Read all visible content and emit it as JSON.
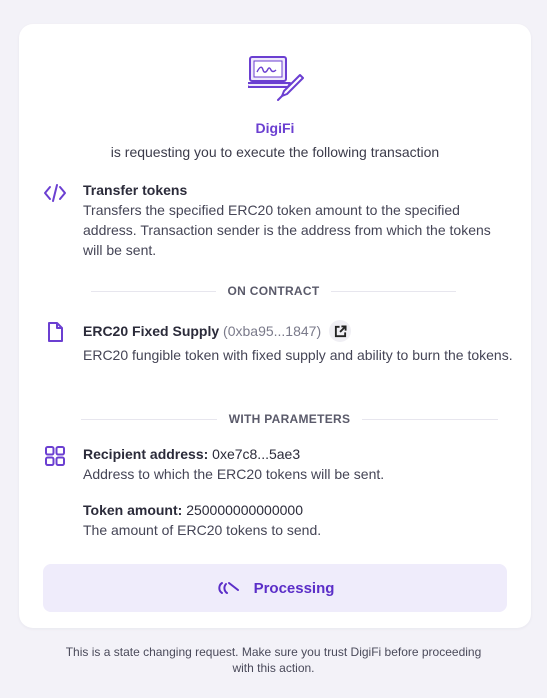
{
  "request": {
    "app_name": "DigiFi",
    "subtitle": "is requesting you to execute the following transaction"
  },
  "method": {
    "icon": "code-icon",
    "title": "Transfer tokens",
    "description": "Transfers the specified ERC20 token amount to the specified address. Transaction sender is the address from which the tokens will be sent."
  },
  "contract": {
    "section_label": "ON CONTRACT",
    "icon": "document-icon",
    "name": "ERC20 Fixed Supply",
    "address": "(0xba95...1847)",
    "description": "ERC20 fungible token with fixed supply and ability to burn the tokens."
  },
  "parameters": {
    "section_label": "WITH PARAMETERS",
    "icon": "grid-icon",
    "items": [
      {
        "label": "Recipient address:",
        "value": "0xe7c8...5ae3",
        "description": "Address to which the ERC20 tokens will be sent."
      },
      {
        "label": "Token amount:",
        "value": "250000000000000",
        "description": "The amount of ERC20 tokens to send."
      }
    ]
  },
  "action": {
    "label": "Processing",
    "icon": "spinner-icon"
  },
  "footer": {
    "text": "This is a state changing request. Make sure you trust DigiFi before proceeding with this action."
  },
  "colors": {
    "accent": "#6b3fd1",
    "button_bg": "#efecfb",
    "page_bg": "#f3f2f8"
  }
}
